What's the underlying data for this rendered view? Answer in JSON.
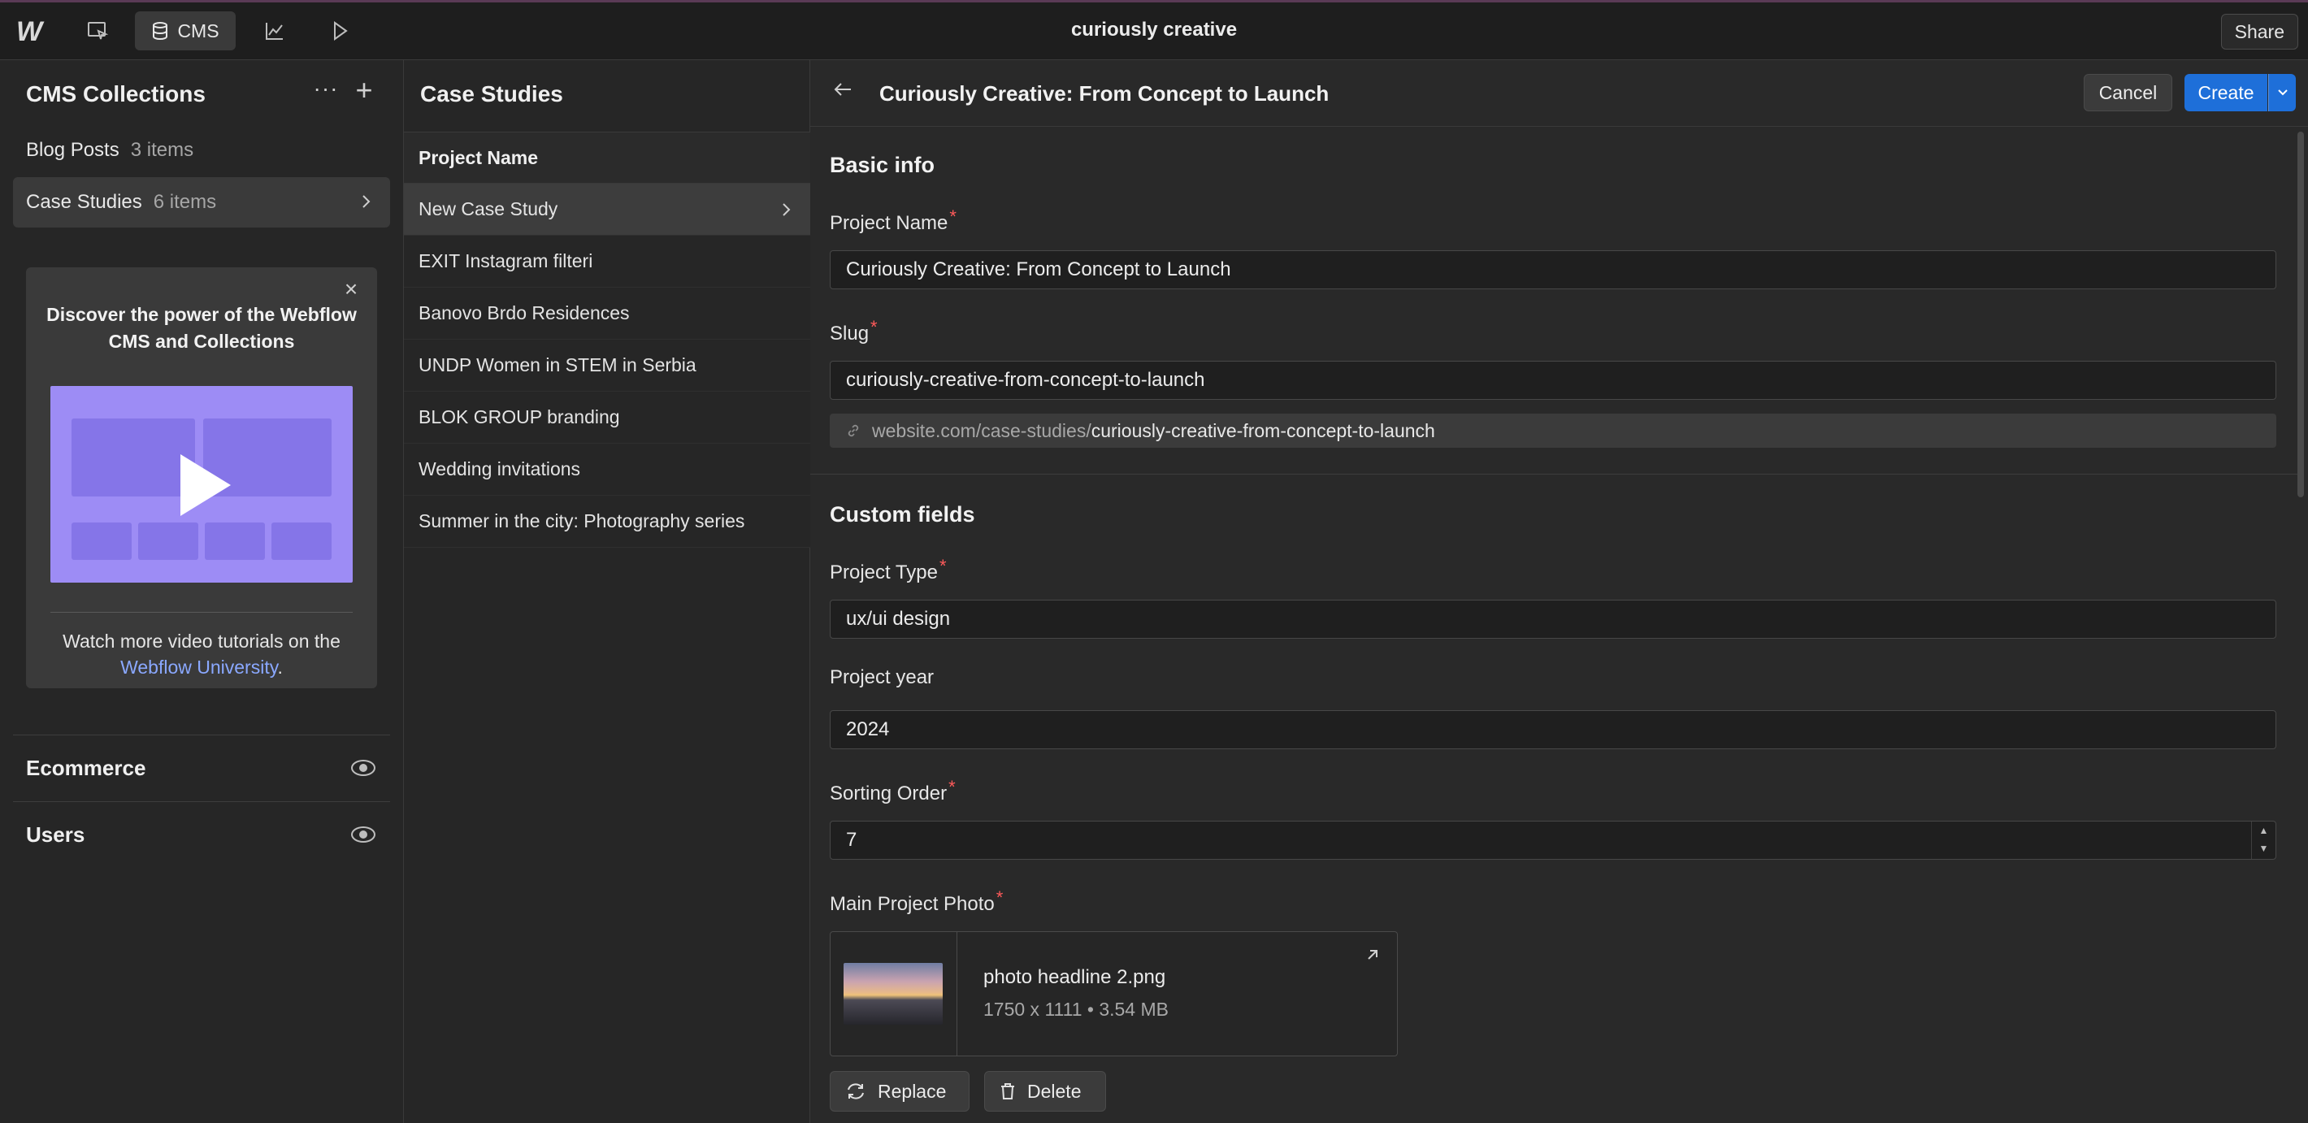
{
  "topbar": {
    "logo": "W",
    "cms_label": "CMS",
    "project_title": "curiously creative",
    "share_label": "Share"
  },
  "collections_panel": {
    "title": "CMS Collections",
    "items": [
      {
        "name": "Blog Posts",
        "count": "3 items"
      },
      {
        "name": "Case Studies",
        "count": "6 items"
      }
    ],
    "promo": {
      "title": "Discover the power of the Webflow CMS and Collections",
      "text": "Watch more video tutorials on the",
      "link": "Webflow University",
      "period": "."
    },
    "sections": [
      {
        "label": "Ecommerce"
      },
      {
        "label": "Users"
      }
    ]
  },
  "items_panel": {
    "title": "Case Studies",
    "column_header": "Project Name",
    "rows": [
      "New Case Study",
      "EXIT Instagram filteri",
      "Banovo Brdo Residences",
      "UNDP Women in STEM in Serbia",
      "BLOK GROUP branding",
      "Wedding invitations",
      "Summer in the city: Photography series"
    ]
  },
  "editor": {
    "title": "Curiously Creative: From Concept to Launch",
    "cancel_label": "Cancel",
    "create_label": "Create",
    "basic_info": {
      "title": "Basic info",
      "project_name_label": "Project Name",
      "project_name_value": "Curiously Creative: From Concept to Launch",
      "slug_label": "Slug",
      "slug_value": "curiously-creative-from-concept-to-launch",
      "slug_url_prefix": "website.com/case-studies/",
      "slug_url_value": "curiously-creative-from-concept-to-launch"
    },
    "custom_fields": {
      "title": "Custom fields",
      "project_type_label": "Project Type",
      "project_type_value": "ux/ui design",
      "project_year_label": "Project year",
      "project_year_value": "2024",
      "sorting_order_label": "Sorting Order",
      "sorting_order_value": "7",
      "main_photo_label": "Main Project Photo",
      "photo_name": "photo headline 2.png",
      "photo_meta": "1750 x 1111 • 3.54 MB",
      "replace_label": "Replace",
      "delete_label": "Delete"
    }
  },
  "colors": {
    "accent": "#1e6fd9",
    "required": "#ff5a5a",
    "promo_video": "#9d8cf5",
    "link": "#8aa8ff"
  }
}
